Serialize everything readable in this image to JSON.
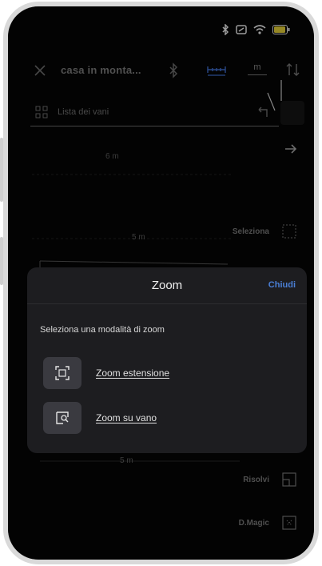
{
  "status_bar": {
    "icons": [
      "bluetooth-icon",
      "nfc-icon",
      "wifi-icon",
      "battery-icon"
    ],
    "battery_level": "82"
  },
  "toolbar": {
    "project_title": "casa in monta...",
    "unit_label": "m"
  },
  "room_list": {
    "label": "Lista dei vani"
  },
  "dimensions": [
    "6 m",
    "5 m",
    "5 m"
  ],
  "tools": {
    "select_label": "Seleziona",
    "resolve_label": "Risolvi",
    "magic_label": "D.Magic"
  },
  "zoom_sheet": {
    "title": "Zoom",
    "close_label": "Chiudi",
    "subtitle": "Seleziona una modalità di zoom",
    "options": [
      {
        "label": "Zoom estensione",
        "icon": "zoom-extent-icon"
      },
      {
        "label": "Zoom su vano",
        "icon": "zoom-room-icon"
      }
    ]
  },
  "colors": {
    "accent": "#4a7fd6",
    "sheet_bg": "#1d1d20",
    "screen_bg": "#050505"
  }
}
